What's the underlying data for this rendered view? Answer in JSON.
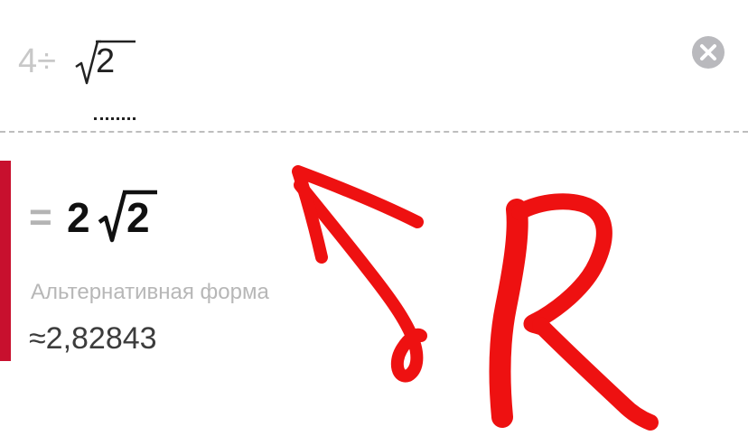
{
  "input": {
    "prefix": "4÷",
    "radicand": "2",
    "clear_icon": "close-icon"
  },
  "result": {
    "equals": "=",
    "coefficient": "2",
    "radicand": "2",
    "alternative_label": "Альтернативная форма",
    "approximate": "≈2,82843"
  },
  "colors": {
    "accent": "#c8102e",
    "annotation": "#ee1111"
  }
}
